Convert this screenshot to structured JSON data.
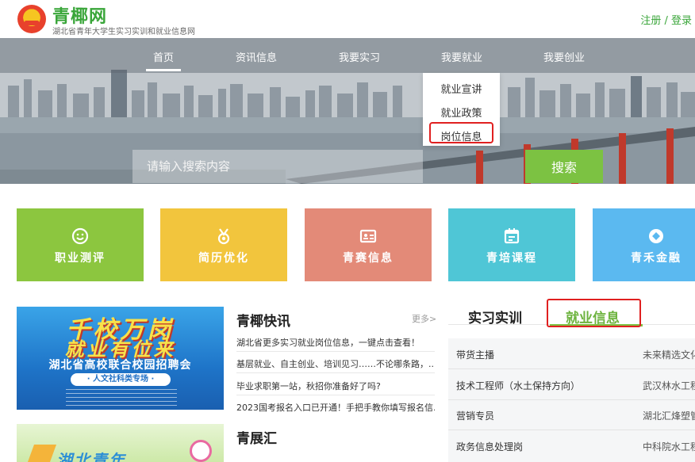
{
  "header": {
    "site_name": "青椰网",
    "subtitle": "湖北省青年大学生实习实训和就业信息网",
    "register": "注册",
    "separator": " / ",
    "login": "登录"
  },
  "nav": {
    "items": [
      "首页",
      "资讯信息",
      "我要实习",
      "我要就业",
      "我要创业"
    ],
    "active": "首页",
    "dropdown": [
      "就业宣讲",
      "就业政策",
      "岗位信息"
    ]
  },
  "search": {
    "placeholder": "请输入搜索内容",
    "button": "搜索"
  },
  "tiles": [
    {
      "label": "职业测评",
      "icon": "smile-icon",
      "color": "#8cc63f"
    },
    {
      "label": "简历优化",
      "icon": "medal-icon",
      "color": "#f2c53d"
    },
    {
      "label": "青赛信息",
      "icon": "id-card-icon",
      "color": "#e38a78"
    },
    {
      "label": "青培课程",
      "icon": "calendar-icon",
      "color": "#4fc6d6"
    },
    {
      "label": "青禾金融",
      "icon": "diamond-icon",
      "color": "#5bb9f0"
    }
  ],
  "poster1": {
    "line1": "千校万岗",
    "line2": "就业有位来",
    "line3": "湖北省高校联合校园招聘会",
    "tag": "· 人文社科类专场 ·"
  },
  "poster2": {
    "text": "湖北青年"
  },
  "news": {
    "title": "青椰快讯",
    "more": "更多>",
    "items": [
      "湖北省更多实习就业岗位信息，一键点击查看！",
      "基层就业、自主创业、培训见习……不论哪条路，...",
      "毕业求职第一站，秋招你准备好了吗?",
      "2023国考报名入口已开通！手把手教你填写报名信..."
    ]
  },
  "expo": {
    "title": "青展汇"
  },
  "right_panel": {
    "tabs": [
      "实习实训",
      "就业信息"
    ],
    "active_tab": "就业信息",
    "jobs": [
      {
        "title": "带货主播",
        "company": "未来精选文化"
      },
      {
        "title": "技术工程师（水土保持方向）",
        "company": "武汉林水工程"
      },
      {
        "title": "营销专员",
        "company": "湖北汇烽塑管"
      },
      {
        "title": "政务信息处理岗",
        "company": "中科院水工程"
      }
    ]
  },
  "colors": {
    "brand_green": "#3aa63a",
    "accent_green": "#7cc242",
    "highlight_red": "#e02020"
  }
}
